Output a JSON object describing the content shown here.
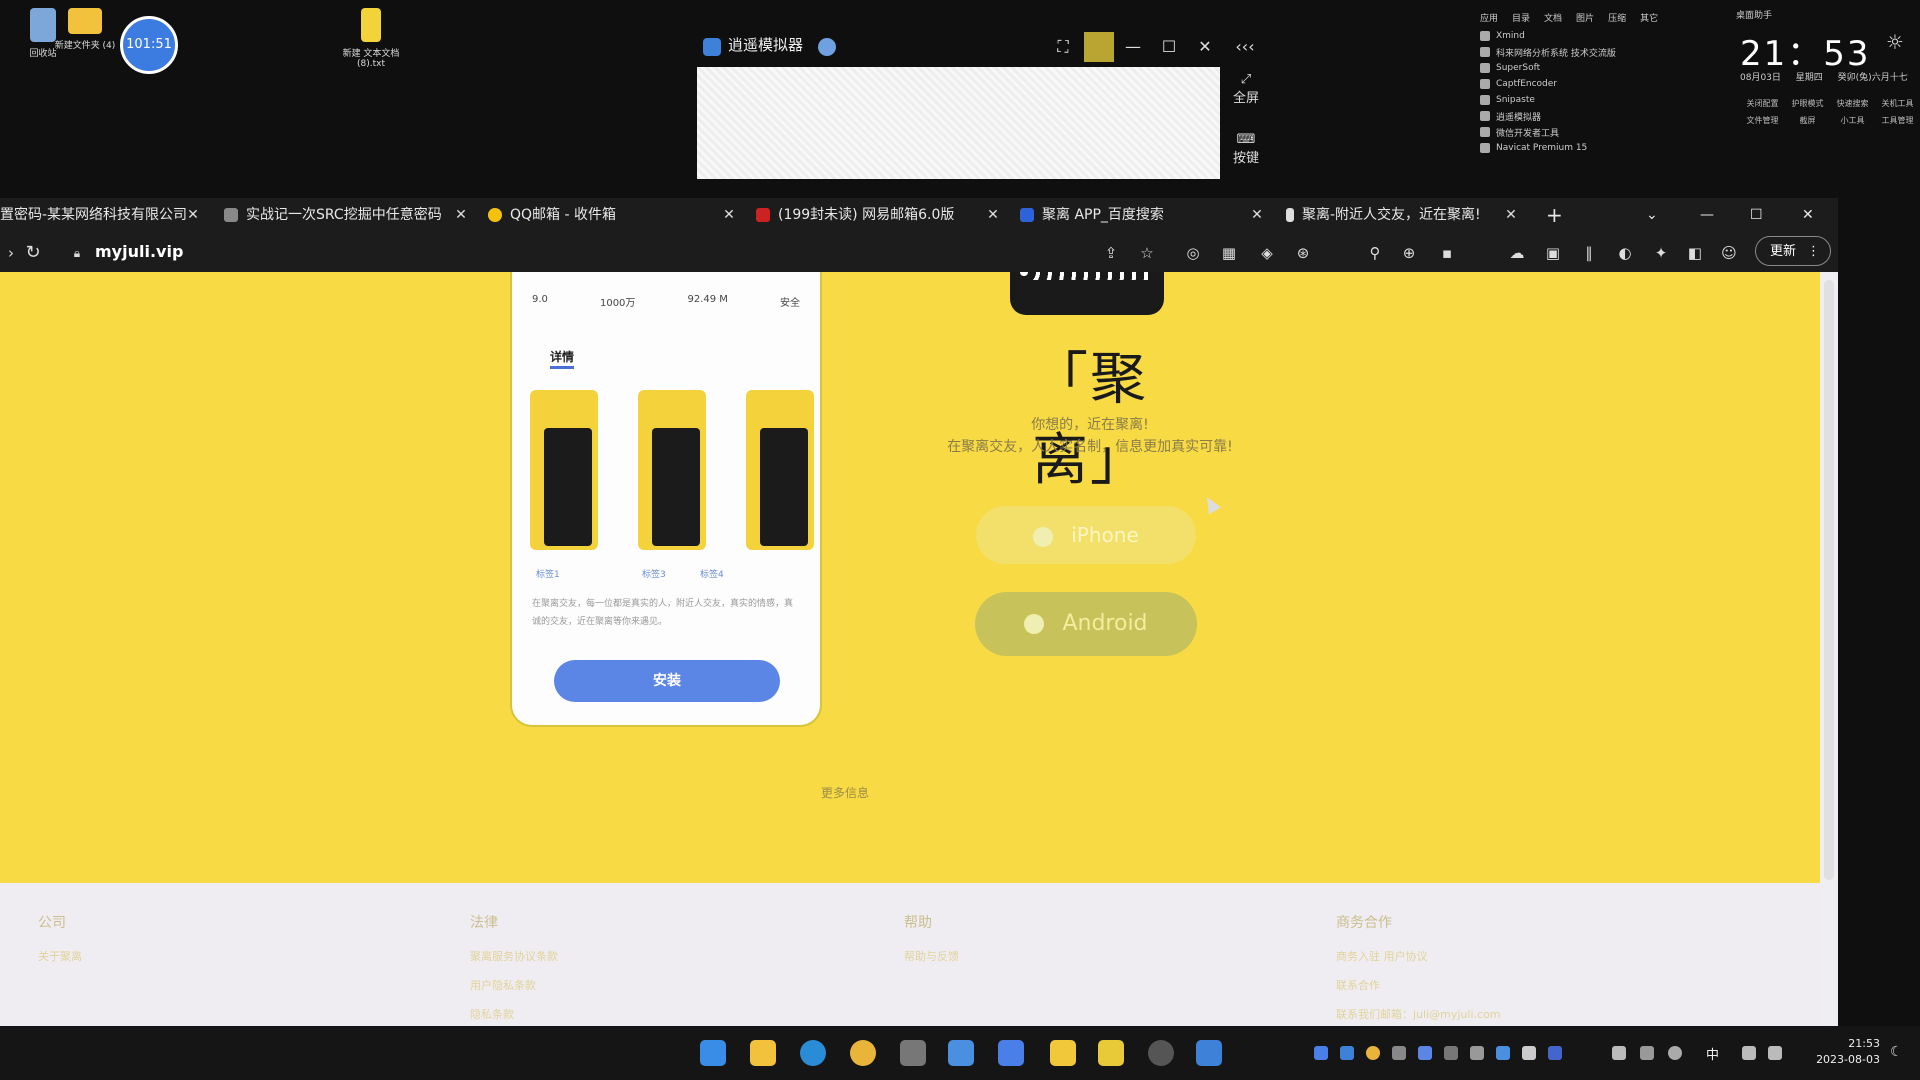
{
  "desktop": {
    "icons": [
      {
        "label": "回收站"
      },
      {
        "label": "新建文件夹 (4)"
      },
      {
        "label": "101:51"
      },
      {
        "label": "新建 文本文档 (8).txt"
      }
    ],
    "emulator": {
      "title": "逍遥模拟器",
      "fullscreen_label": "全屏",
      "keys_label": "按键"
    },
    "launcher": {
      "header_items": [
        "应用",
        "目录",
        "文档",
        "图片",
        "压缩",
        "其它"
      ],
      "apps": [
        "Xmind",
        "科来网络分析系统 技术交流版",
        "SuperSoft",
        "CaptfEncoder",
        "Snipaste",
        "逍遥模拟器",
        "微信开发者工具",
        "Navicat Premium 15"
      ]
    },
    "clock": {
      "header": "桌面助手",
      "time": "21：53",
      "date": "08月03日",
      "weekday": "星期四",
      "lunar": "癸卯(兔)六月十七",
      "quick_actions": [
        "关闭配置",
        "护眼模式",
        "快速搜索",
        "关机工具",
        "文件管理",
        "截屏",
        "小工具",
        "工具管理"
      ]
    }
  },
  "browser": {
    "tabs": [
      {
        "title": "置密码-某某网络科技有限公司",
        "color": "#cc3333"
      },
      {
        "title": "实战记一次SRC挖掘中任意密码",
        "color": "#888888"
      },
      {
        "title": "QQ邮箱 - 收件箱",
        "color": "#f4c20d"
      },
      {
        "title": "(199封未读) 网易邮箱6.0版",
        "color": "#cc2222"
      },
      {
        "title": "聚离 APP_百度搜索",
        "color": "#2e62d9"
      },
      {
        "title": "聚离-附近人交友，近在聚离!",
        "color": "#dddddd"
      }
    ],
    "url": "myjuli.vip",
    "update_label": "更新"
  },
  "page": {
    "phone": {
      "stats": [
        "9.0",
        "1000万",
        "92.49 M",
        "安全"
      ],
      "tab_label": "详情",
      "captions": [
        "标签1",
        "标签3",
        "标签4"
      ],
      "description": "在聚离交友，每一位都是真实的人，附近人交友，真实的情感，真诚的交友，近在聚离等你来遇见。",
      "install_label": "安装"
    },
    "brand": "「聚离」",
    "tagline1": "你想的，近在聚离!",
    "tagline2": "在聚离交友，人人实名制，信息更加真实可靠!",
    "ios_label": "iPhone",
    "android_label": "Android",
    "more_label": "更多信息"
  },
  "footer": {
    "columns": [
      {
        "heading": "公司",
        "links": [
          "关于聚离"
        ]
      },
      {
        "heading": "法律",
        "links": [
          "聚离服务协议条款",
          "用户隐私条款",
          "隐私条款"
        ]
      },
      {
        "heading": "帮助",
        "links": [
          "帮助与反馈"
        ]
      },
      {
        "heading": "商务合作",
        "links": [
          "商务入驻 用户协议",
          "联系合作",
          "联系我们邮箱：juli@myjuli.com"
        ]
      }
    ]
  },
  "taskbar": {
    "time": "21:53",
    "date": "2023-08-03",
    "ime": "中"
  }
}
